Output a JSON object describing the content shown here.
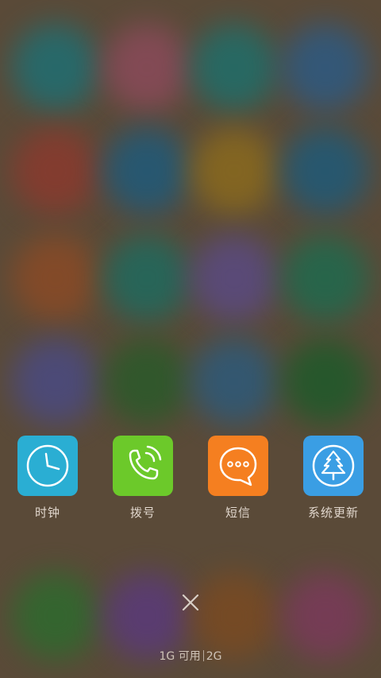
{
  "recent_apps": [
    {
      "label": "时钟",
      "icon": "clock-icon",
      "color": "#2aaed3"
    },
    {
      "label": "拨号",
      "icon": "phone-icon",
      "color": "#6cc92a"
    },
    {
      "label": "短信",
      "icon": "message-icon",
      "color": "#f57f20"
    },
    {
      "label": "系统更新",
      "icon": "tree-update-icon",
      "color": "#3a9ee4"
    }
  ],
  "close_icon": "close-icon",
  "memory": {
    "available": "1G 可用",
    "total": "2G"
  },
  "background_color": "#5a4a38"
}
